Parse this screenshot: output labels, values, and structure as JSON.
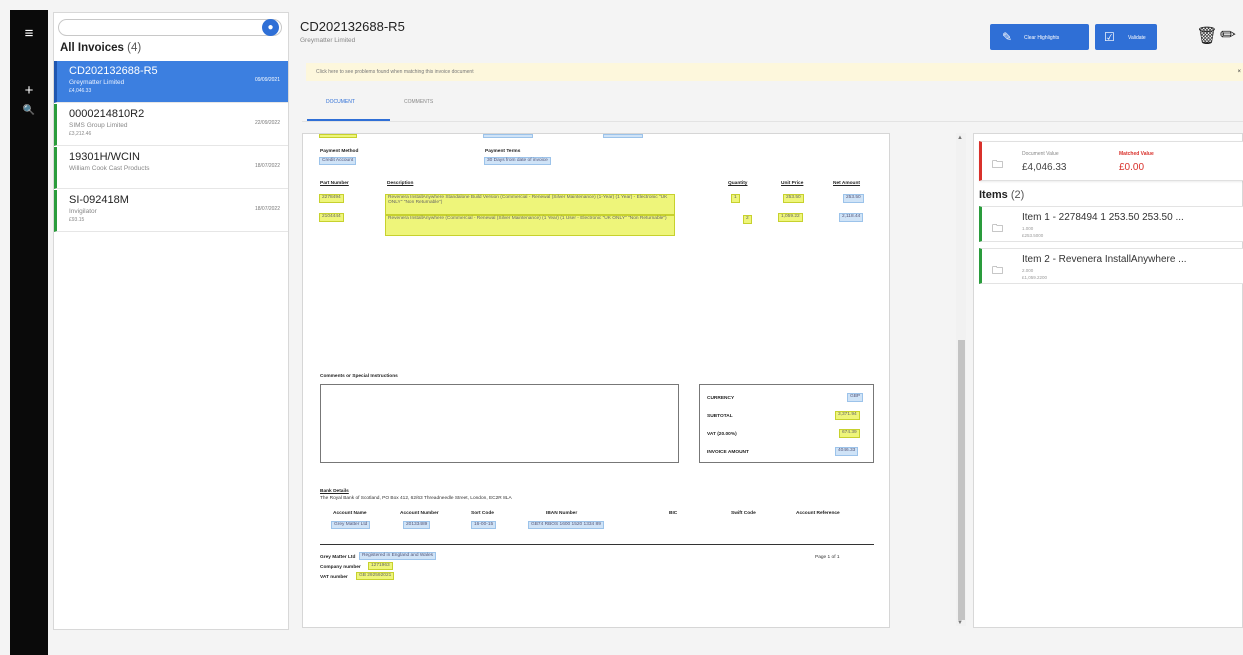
{
  "rail": {
    "menu_icon": "≡",
    "add_icon": "+",
    "search_icon": "🔍"
  },
  "list": {
    "search_placeholder": "",
    "title": "All Invoices",
    "count": "(4)",
    "invoices": [
      {
        "number": "CD202132688-R5",
        "supplier": "Greymatter Limited",
        "amount": "£4,046.33",
        "date": "09/09/2021"
      },
      {
        "number": "0000214810R2",
        "supplier": "SIMS Group Limited",
        "amount": "£3,212.46",
        "date": "22/09/2022"
      },
      {
        "number": "19301H/WCIN",
        "supplier": "William Cook Cast Products",
        "amount": "",
        "date": "18/07/2022"
      },
      {
        "number": "SI-092418M",
        "supplier": "Invigilator",
        "amount": "£93.15",
        "date": "18/07/2022"
      }
    ]
  },
  "header": {
    "title": "CD202132688-R5",
    "subtitle": "Greymatter Limited",
    "clear_highlights": "Clear Highlights",
    "validate": "Validate",
    "clear_icon": "eraser-icon",
    "validate_icon": "checkbox-icon"
  },
  "banner": {
    "text": "Click here to see problems found when matching this invoice document",
    "close": "×"
  },
  "tabs": {
    "document": "DOCUMENT",
    "comments": "COMMENTS"
  },
  "document": {
    "payment_method_label": "Payment Method",
    "payment_method": "Credit Account",
    "payment_terms_label": "Payment Terms",
    "payment_terms": "30 Days from date of invoice",
    "col_part": "Part Number",
    "col_desc": "Description",
    "col_qty": "Quantity",
    "col_price": "Unit Price",
    "col_net": "Net Amount",
    "lines": [
      {
        "part": "2278494",
        "desc": "Revenera InstallAnywhere Standalone Build Version (Commercial - Renewal (Silver Maintenance) (1-Year) (1 Year) - Electronic \"UK ONLY\" \"Non Returnable\")",
        "qty": "1",
        "price": "253.50",
        "net": "253.50"
      },
      {
        "part": "2104444",
        "desc": "Revenera InstallAnywhere (Commercial - Renewal (Silver Maintenance) (1 Year) (1 User - Electronic \"UK ONLY\" \"Non Returnable\")",
        "qty": "2",
        "price": "1,059.22",
        "net": "2,118.44"
      }
    ],
    "comments_label": "Comments or Special Instructions",
    "currency_label": "CURRENCY",
    "currency": "GBP",
    "subtotal_label": "SUBTOTAL",
    "subtotal": "3,371.94",
    "vat_label": "VAT (20.00%)",
    "vat": "674.39",
    "invoice_amount_label": "INVOICE AMOUNT",
    "invoice_amount": "4046.33",
    "bank_label": "Bank Details",
    "bank_address": "The Royal Bank of Scotland, PO Box 412, 62/63 Threadneedle Street, London, EC2R 8LA",
    "bank_cols": [
      "Account Name",
      "Account Number",
      "Sort Code",
      "IBAN Number",
      "BIC",
      "Swift Code",
      "Account Reference"
    ],
    "bank_vals": [
      "Grey Matter Ltd",
      "20133489",
      "16-00-15",
      "GB74 RBOS 1600 1520 1334 89"
    ],
    "footer_company": "Grey Matter Ltd",
    "footer_reg": "Registered in England and Wales",
    "footer_company_no_label": "Company number",
    "footer_company_no": "1271963",
    "footer_vat_label": "VAT number",
    "footer_vat": "GB 292592021",
    "page": "Page 1 of 1"
  },
  "right": {
    "doc_value_label": "Document Value",
    "doc_value": "£4,046.33",
    "matched_label": "Matched Value",
    "matched_value": "£0.00",
    "items_title": "Items",
    "items_count": "(2)",
    "items": [
      {
        "name": "Item 1 - 2278494 1 253.50 253.50 ...",
        "qty": "1.000",
        "amount": "£253.5000"
      },
      {
        "name": "Item 2 - Revenera InstallAnywhere ...",
        "qty": "2.000",
        "amount": "£1,059.2200"
      }
    ]
  },
  "colors": {
    "accent": "#2f6fd6",
    "green": "#2a9c3c",
    "red": "#d9312b",
    "highlight_yellow": "#eef57a",
    "highlight_blue": "#cfe3f7"
  }
}
